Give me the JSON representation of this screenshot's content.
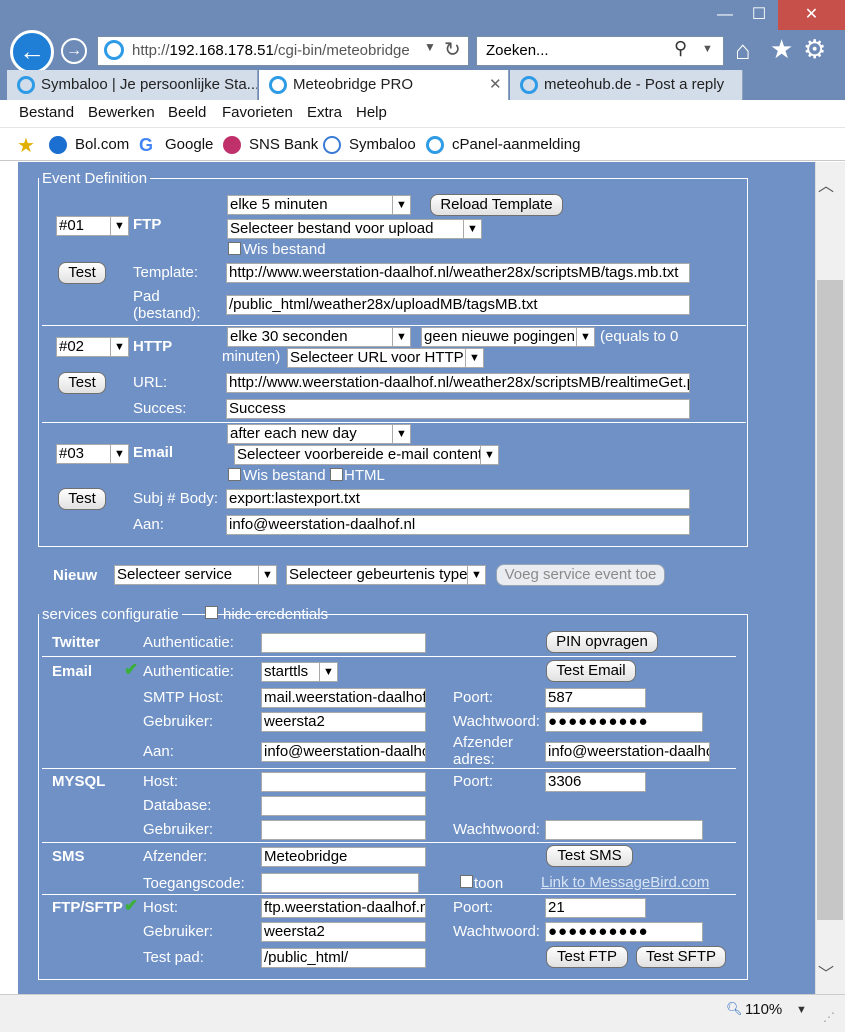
{
  "browser": {
    "window_controls": {
      "minimize": "—",
      "maximize": "☐",
      "close": "✕"
    },
    "address": {
      "prefix": "http://",
      "host": "192.168.178.51",
      "path": "/cgi-bin/meteobridge"
    },
    "search_placeholder": "Zoeken...",
    "tabs": [
      {
        "label": "Symbaloo | Je persoonlijke Sta..."
      },
      {
        "label": "Meteobridge PRO"
      },
      {
        "label": "meteohub.de - Post a reply"
      }
    ],
    "menu": [
      "Bestand",
      "Bewerken",
      "Beeld",
      "Favorieten",
      "Extra",
      "Help"
    ],
    "favorites": [
      "Bol.com",
      "Google",
      "SNS Bank",
      "Symbaloo",
      "cPanel-aanmelding"
    ],
    "zoom": "110%"
  },
  "event_definition": {
    "legend": "Event Definition",
    "test_label": "Test",
    "events": [
      {
        "number": "#01",
        "type": "FTP",
        "interval": "elke 5 minuten",
        "reload_label": "Reload Template",
        "file_select": "Selecteer bestand voor upload",
        "delete_label": "Wis bestand",
        "template_label": "Template:",
        "template_value": "http://www.weerstation-daalhof.nl/weather28x/scriptsMB/tags.mb.txt",
        "path_label_1": "Pad",
        "path_label_2": "(bestand):",
        "path_value": "/public_html/weather28x/uploadMB/tagsMB.txt"
      },
      {
        "number": "#02",
        "type": "HTTP",
        "interval": "elke 30 seconden",
        "retries": "geen nieuwe pogingen",
        "equals_note_1": "(equals to 0",
        "equals_note_2": "minuten)",
        "url_select": "Selecteer URL voor HTTP",
        "url_label": "URL:",
        "url_value": "http://www.weerstation-daalhof.nl/weather28x/scriptsMB/realtimeGet.php",
        "success_label": "Succes:",
        "success_value": "Success"
      },
      {
        "number": "#03",
        "type": "Email",
        "interval": "after each new day",
        "content_select": "Selecteer voorbereide e-mail content",
        "delete_label": "Wis bestand",
        "html_label": "HTML",
        "subject_label": "Subj # Body:",
        "subject_value": "export:lastexport.txt",
        "to_label": "Aan:",
        "to_value": "info@weerstation-daalhof.nl"
      }
    ]
  },
  "new_event": {
    "label": "Nieuw",
    "service_select": "Selecteer service",
    "type_select": "Selecteer gebeurtenis type",
    "add_button": "Voeg service event toe"
  },
  "services": {
    "legend": "services configuratie",
    "hide_credentials": "hide credentials",
    "twitter": {
      "name": "Twitter",
      "auth_label": "Authenticatie:",
      "auth_value": "",
      "pin_button": "PIN opvragen"
    },
    "email": {
      "name": "Email",
      "auth_label": "Authenticatie:",
      "auth_value": "starttls",
      "test_button": "Test Email",
      "smtp_label": "SMTP Host:",
      "smtp_value": "mail.weerstation-daalhof.nl",
      "port_label": "Poort:",
      "port_value": "587",
      "user_label": "Gebruiker:",
      "user_value": "weersta2",
      "password_label": "Wachtwoord:",
      "password_value": "●●●●●●●●●●",
      "to_label": "Aan:",
      "to_value": "info@weerstation-daalhof.nl",
      "sender_label_1": "Afzender",
      "sender_label_2": "adres:",
      "sender_value": "info@weerstation-daalhof.nl"
    },
    "mysql": {
      "name": "MYSQL",
      "host_label": "Host:",
      "host_value": "",
      "port_label": "Poort:",
      "port_value": "3306",
      "db_label": "Database:",
      "db_value": "",
      "user_label": "Gebruiker:",
      "user_value": "",
      "password_label": "Wachtwoord:",
      "password_value": ""
    },
    "sms": {
      "name": "SMS",
      "sender_label": "Afzender:",
      "sender_value": "Meteobridge",
      "test_button": "Test SMS",
      "code_label": "Toegangscode:",
      "code_value": "",
      "show_label": "toon",
      "link": "Link to MessageBird.com"
    },
    "ftp": {
      "name": "FTP/SFTP",
      "host_label": "Host:",
      "host_value": "ftp.weerstation-daalhof.nl",
      "port_label": "Poort:",
      "port_value": "21",
      "user_label": "Gebruiker:",
      "user_value": "weersta2",
      "password_label": "Wachtwoord:",
      "password_value": "●●●●●●●●●●",
      "path_label": "Test pad:",
      "path_value": "/public_html/",
      "test_ftp": "Test FTP",
      "test_sftp": "Test SFTP"
    }
  },
  "colors": {
    "page_background": "#6f91c5",
    "chrome": "#6d8bb6",
    "check": "#3ab03a"
  }
}
